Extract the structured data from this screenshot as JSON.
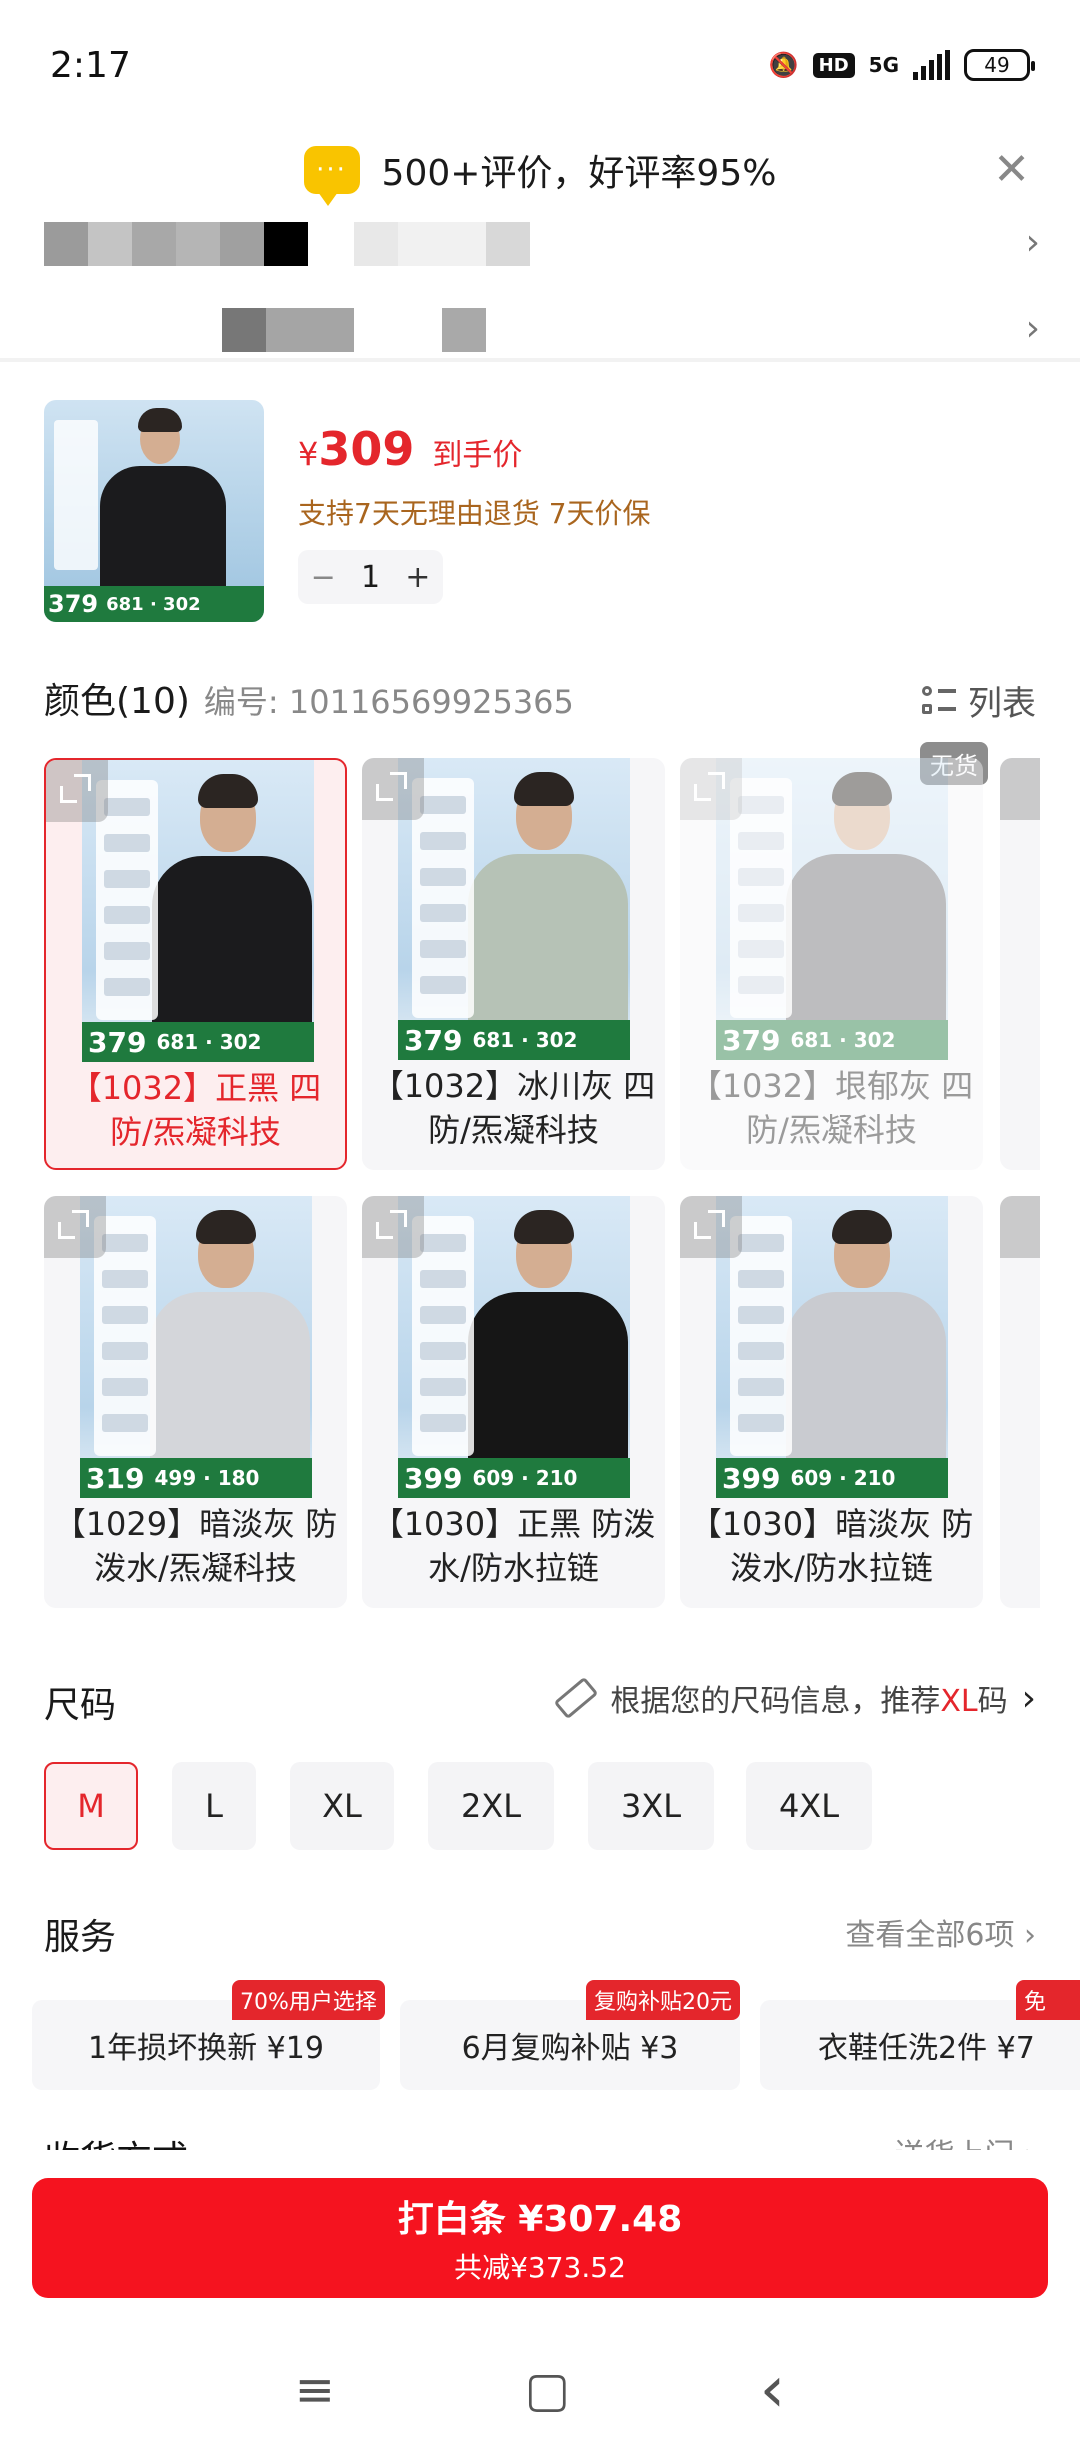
{
  "status_bar": {
    "time": "2:17",
    "network": "5G",
    "hd": "HD",
    "battery": "49"
  },
  "review_banner": {
    "icon": "chat-bubble-icon",
    "text": "500+评价，好评率95%",
    "close_icon": "close-icon"
  },
  "product": {
    "price_symbol": "¥",
    "price": "309",
    "price_label": "到手价",
    "policy": "支持7天无理由退货  7天价保",
    "quantity": "1",
    "minus": "−",
    "plus": "+"
  },
  "color_section": {
    "title": "颜色(10)",
    "sku_label": "编号: 10116569925365",
    "list_toggle": "列表",
    "out_of_stock_badge": "无货",
    "options": [
      {
        "label": "【1032】正黑 四防/炁凝科技",
        "price": "379",
        "strip": "681 · 302",
        "jacket_color": "#1b1b1d",
        "state": "selected"
      },
      {
        "label": "【1032】冰川灰 四防/炁凝科技",
        "price": "379",
        "strip": "681 · 302",
        "jacket_color": "#b6c2b6",
        "state": "normal"
      },
      {
        "label": "【1032】垠郁灰 四防/炁凝科技",
        "price": "379",
        "strip": "681 · 302",
        "jacket_color": "#6e6e72",
        "state": "out_of_stock"
      },
      {
        "label": "【1029】暗淡灰 防泼水/炁凝科技",
        "price": "319",
        "strip": "499 · 180",
        "jacket_color": "#d4d6da",
        "state": "normal"
      },
      {
        "label": "【1030】正黑 防泼水/防水拉链",
        "price": "399",
        "strip": "609 · 210",
        "jacket_color": "#161616",
        "state": "normal"
      },
      {
        "label": "【1030】暗淡灰 防泼水/防水拉链",
        "price": "399",
        "strip": "609 · 210",
        "jacket_color": "#c9cbd0",
        "state": "normal"
      }
    ]
  },
  "size_section": {
    "title": "尺码",
    "hint_prefix": "根据您的尺码信息，推荐",
    "hint_size": "XL",
    "hint_suffix": "码",
    "selected": "M",
    "sizes": [
      "M",
      "L",
      "XL",
      "2XL",
      "3XL",
      "4XL"
    ]
  },
  "service_section": {
    "title": "服务",
    "view_all": "查看全部6项  ›",
    "items": [
      {
        "label": "1年损坏换新  ¥19",
        "tag": "70%用户选择"
      },
      {
        "label": "6月复购补贴  ¥3",
        "tag": "复购补贴20元"
      },
      {
        "label": "衣鞋任洗2件  ¥7",
        "tag": "免"
      }
    ]
  },
  "delivery_section": {
    "title": "收货方式",
    "right": "送货上门  ›"
  },
  "buy_button": {
    "main": "打白条 ¥307.48",
    "sub": "共减¥373.52"
  },
  "nav_bar": {
    "menu": "≡",
    "home": "▢",
    "back": "‹"
  },
  "colors": {
    "accent_red": "#e4262c",
    "button_red": "#f5131f",
    "policy_brown": "#a9651e"
  }
}
